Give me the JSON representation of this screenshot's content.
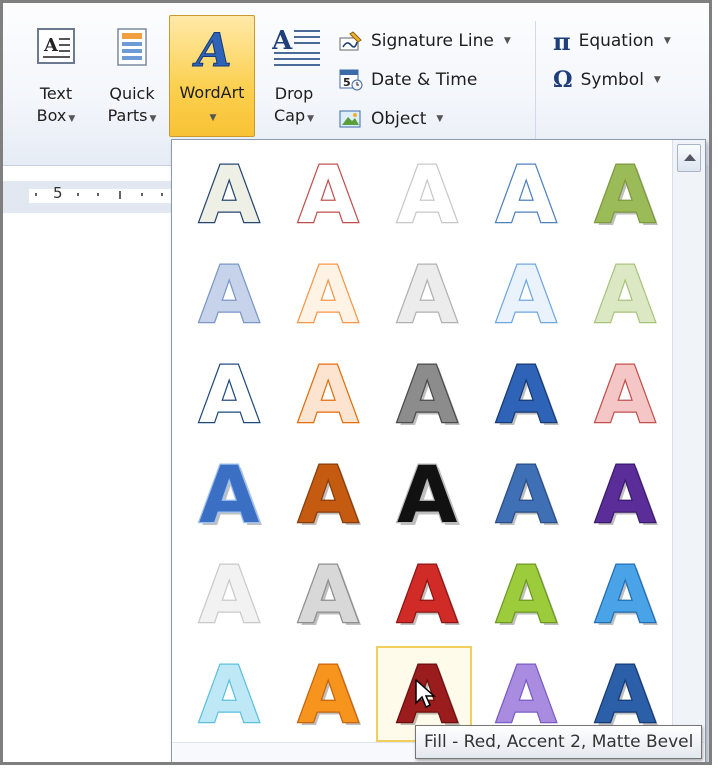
{
  "ribbon": {
    "text_box": {
      "line1": "Text",
      "line2": "Box",
      "icon": "text-box-icon"
    },
    "quick_parts": {
      "line1": "Quick",
      "line2": "Parts",
      "icon": "quick-parts-icon"
    },
    "wordart": {
      "label": "WordArt",
      "icon": "wordart-icon"
    },
    "drop_cap": {
      "line1": "Drop",
      "line2": "Cap",
      "icon": "drop-cap-icon"
    },
    "signature_line": {
      "label": "Signature Line",
      "icon": "signature-line-icon"
    },
    "date_time": {
      "label": "Date & Time",
      "icon": "date-time-icon",
      "badge": "5"
    },
    "object": {
      "label": "Object",
      "icon": "object-icon"
    },
    "equation": {
      "label": "Equation",
      "icon": "pi-icon",
      "glyph": "π"
    },
    "symbol": {
      "label": "Symbol",
      "icon": "omega-icon",
      "glyph": "Ω"
    }
  },
  "ruler": {
    "number": "5"
  },
  "gallery": {
    "glyph": "A",
    "selected_index": 27,
    "styles": [
      {
        "fill": "#eef0e6",
        "stroke": "#26456e",
        "shadow": false
      },
      {
        "fill": "#ffffff",
        "stroke": "#c0504d",
        "shadow": false
      },
      {
        "fill": "#ffffff",
        "stroke": "#c8c8c8",
        "shadow": false
      },
      {
        "fill": "#ffffff",
        "stroke": "#4f81bd",
        "shadow": false
      },
      {
        "fill": "#9bbb59",
        "stroke": "#7c9a3e",
        "shadow": true
      },
      {
        "fill": "#c6d3ea",
        "stroke": "#7a96c8",
        "shadow": false
      },
      {
        "fill": "#fff3e6",
        "stroke": "#f79646",
        "shadow": false
      },
      {
        "fill": "#ececec",
        "stroke": "#b0b0b0",
        "shadow": false
      },
      {
        "fill": "#eaf2fb",
        "stroke": "#6fa7e0",
        "shadow": false
      },
      {
        "fill": "#dbe8c3",
        "stroke": "#a8c47c",
        "shadow": false
      },
      {
        "fill": "#ffffff",
        "stroke": "#1f497d",
        "shadow": false
      },
      {
        "fill": "#fde4d0",
        "stroke": "#e46c0a",
        "shadow": false
      },
      {
        "fill": "#8c8c8c",
        "stroke": "#4a4a4a",
        "shadow": true
      },
      {
        "fill": "#2e63b8",
        "stroke": "#163a75",
        "shadow": true
      },
      {
        "fill": "#f4c6c5",
        "stroke": "#c0504d",
        "shadow": false
      },
      {
        "fill": "#3a6fc4",
        "stroke": "#9cc0f0",
        "shadow": true
      },
      {
        "fill": "#c55a11",
        "stroke": "#8a3c06",
        "shadow": true
      },
      {
        "fill": "#111111",
        "stroke": "#bbbbbb",
        "shadow": true
      },
      {
        "fill": "#3f6fb5",
        "stroke": "#2a4d86",
        "shadow": true
      },
      {
        "fill": "#5b2d99",
        "stroke": "#3b1a6e",
        "shadow": true
      },
      {
        "fill": "#f2f2f2",
        "stroke": "#c9c9c9",
        "shadow": false
      },
      {
        "fill": "#d8d8d8",
        "stroke": "#8e8e8e",
        "shadow": true
      },
      {
        "fill": "#d12b27",
        "stroke": "#8e1512",
        "shadow": true
      },
      {
        "fill": "#9ccc3c",
        "stroke": "#6c9a1f",
        "shadow": true
      },
      {
        "fill": "#4aa3e6",
        "stroke": "#1f6fb5",
        "shadow": true
      },
      {
        "fill": "#bfe8f7",
        "stroke": "#5bc0de",
        "shadow": false
      },
      {
        "fill": "#f7941d",
        "stroke": "#c8640a",
        "shadow": true
      },
      {
        "fill": "#9b1c1c",
        "stroke": "#6d0f0f",
        "shadow": true
      },
      {
        "fill": "#a98ce0",
        "stroke": "#7b5bc4",
        "shadow": false
      },
      {
        "fill": "#2b5fa8",
        "stroke": "#163a75",
        "shadow": true
      }
    ]
  },
  "tooltip": {
    "text": "Fill - Red, Accent 2, Matte Bevel"
  }
}
